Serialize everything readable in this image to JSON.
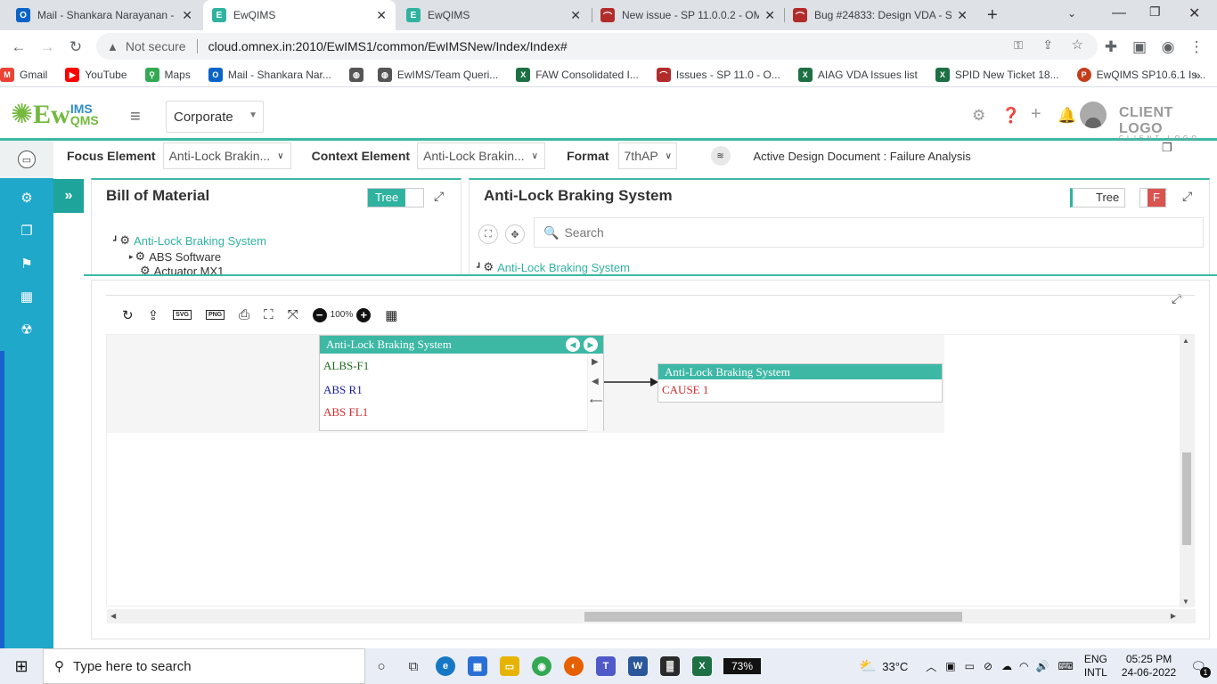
{
  "browser": {
    "tabs": [
      {
        "title": "Mail - Shankara Narayanan -",
        "icon": "outlook-icon",
        "color": "#0a64c8"
      },
      {
        "title": "EwQIMS",
        "icon": "ewqims-icon",
        "color": "#2fb3a0",
        "active": true
      },
      {
        "title": "EwQIMS",
        "icon": "ewqims-icon",
        "color": "#2fb3a0"
      },
      {
        "title": "New issue - SP 11.0.0.2 - OM",
        "icon": "redmine-icon",
        "color": "#b32c2c"
      },
      {
        "title": "Bug #24833: Design VDA - S",
        "icon": "redmine-icon",
        "color": "#b32c2c"
      }
    ],
    "new_tab": "+",
    "url_not_secure": "Not secure",
    "url": "cloud.omnex.in:2010/EwIMS1/common/EwIMSNew/Index/Index#",
    "bookmarks": [
      {
        "label": "Gmail",
        "icon": "gmail-icon",
        "color": "#ea4335"
      },
      {
        "label": "YouTube",
        "icon": "youtube-icon",
        "color": "#ff0000"
      },
      {
        "label": "Maps",
        "icon": "maps-icon",
        "color": "#34a853"
      },
      {
        "label": "Mail - Shankara Nar...",
        "icon": "outlook-icon",
        "color": "#0a64c8"
      },
      {
        "label": "",
        "icon": "globe-icon",
        "color": "#555555"
      },
      {
        "label": "EwIMS/Team Queri...",
        "icon": "globe-icon",
        "color": "#555555"
      },
      {
        "label": "FAW Consolidated I...",
        "icon": "excel-icon",
        "color": "#1d7044"
      },
      {
        "label": "Issues - SP 11.0 - O...",
        "icon": "redmine-icon",
        "color": "#b32c2c"
      },
      {
        "label": "AIAG VDA Issues list",
        "icon": "excel-icon",
        "color": "#1d7044"
      },
      {
        "label": "SPID New Ticket 18...",
        "icon": "excel-icon",
        "color": "#1d7044"
      },
      {
        "label": "EwQIMS SP10.6.1 Is...",
        "icon": "powerpoint-icon",
        "color": "#c43e1c"
      }
    ],
    "more": "»"
  },
  "header": {
    "logo_main": "Ew",
    "logo_ims": "IMS",
    "logo_qms": "QMS",
    "corporate": "Corporate",
    "client_logo": "CLIENT LOGO",
    "client_logo_sub": "CLIENT LOGO"
  },
  "context": {
    "focus_label": "Focus Element",
    "focus_value": "Anti-Lock Brakin...",
    "context_label": "Context Element",
    "context_value": "Anti-Lock Brakin...",
    "format_label": "Format",
    "format_value": "7thAP",
    "active_doc": "Active Design Document : Failure Analysis"
  },
  "bom": {
    "title": "Bill of Material",
    "toggle": "Tree",
    "tree": [
      "Anti-Lock Braking System",
      "ABS Software",
      "Actuator MX1"
    ]
  },
  "abs_panel": {
    "title": "Anti-Lock Braking System",
    "toggle": "Tree",
    "f_badge": "F",
    "search_placeholder": "Search",
    "tree_root": "Anti-Lock Braking System"
  },
  "diagram": {
    "zoom": "100%",
    "left_node": {
      "title": "Anti-Lock Braking System",
      "rows": [
        {
          "text": "ALBS-F1",
          "color": "#1e6b1e"
        },
        {
          "text": "ABS R1",
          "color": "#1a1aa6"
        },
        {
          "text": "ABS FL1",
          "color": "#d22d2d"
        }
      ]
    },
    "right_node": {
      "title": "Anti-Lock Braking System",
      "rows": [
        {
          "text": "CAUSE 1",
          "color": "#d22d2d"
        }
      ]
    }
  },
  "taskbar": {
    "search": "Type here to search",
    "battery": "73%",
    "temperature": "33°C",
    "lang_top": "ENG",
    "lang_bottom": "INTL",
    "time": "05:25 PM",
    "date": "24-06-2022",
    "notifications": "1"
  },
  "colors": {
    "accent": "#3db8a5",
    "sidebar": "#1fa8c9"
  }
}
